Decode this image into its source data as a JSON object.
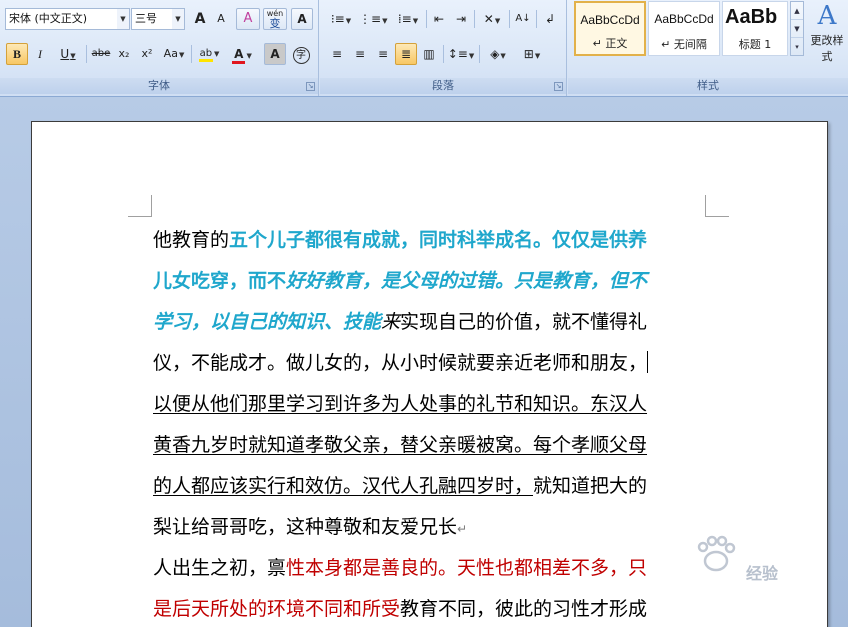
{
  "ribbon": {
    "font_group": {
      "label": "字体",
      "font_name": "宋体 (中文正文)",
      "font_size": "三号",
      "grow_font": "A",
      "shrink_font": "A",
      "clear_format": "A",
      "phonetic": "wén",
      "phonetic_char": "变",
      "char_border": "A",
      "bold": "B",
      "italic": "I",
      "underline": "U",
      "strikethrough": "abe",
      "subscript": "x₂",
      "superscript": "x²",
      "change_case": "Aa",
      "highlight": "ab",
      "font_color": "A",
      "char_shading": "A",
      "enclose": "字"
    },
    "paragraph_group": {
      "label": "段落"
    },
    "styles_group": {
      "label": "样式",
      "styles": [
        {
          "sample": "AaBbCcDd",
          "name": "↵ 正文"
        },
        {
          "sample": "AaBbCcDd",
          "name": "↵ 无间隔"
        },
        {
          "sample": "AaBb",
          "name": "标题 1"
        }
      ],
      "change_styles": "更改样式"
    }
  },
  "document": {
    "lines": [
      [
        {
          "t": "他教育的",
          "c": "plain"
        },
        {
          "t": "五个儿子都很有成就，同时科举成名。仅仅是供养",
          "c": "cyan"
        }
      ],
      [
        {
          "t": "儿女吃穿，而不",
          "c": "cyan"
        },
        {
          "t": "好好教育，是父母的过错。只是教育，但不",
          "c": "cyan-i"
        }
      ],
      [
        {
          "t": "学习，以自己的知识、技能",
          "c": "cyan-i"
        },
        {
          "t": "来",
          "c": "italic"
        },
        {
          "t": "实现自己的价值，就不懂得礼",
          "c": "plain"
        }
      ],
      [
        {
          "t": "仪，不能成才。做儿女的，从小时候就要亲近老师和朋友，",
          "c": "plain"
        }
      ],
      [
        {
          "t": "以便从他们那里学习到许多为人处事的礼节和知识。东汉人",
          "c": "ul"
        }
      ],
      [
        {
          "t": "黄香九岁时就知道孝敬父亲，替父亲暖被窝。每个孝顺父母",
          "c": "ul"
        }
      ],
      [
        {
          "t": "的人都应该实行和效仿。汉代人孔融四岁时，",
          "c": "ul"
        },
        {
          "t": "就知道把大的",
          "c": "plain"
        }
      ],
      [
        {
          "t": "梨让给哥哥吃，这种尊敬和友爱兄长",
          "c": "plain"
        }
      ],
      [
        {
          "t": "人出生之初，禀",
          "c": "plain"
        },
        {
          "t": "性本身都是善良的。天性也都相差不多，只",
          "c": "red"
        }
      ],
      [
        {
          "t": "是后天所处的环境不同和所受",
          "c": "red"
        },
        {
          "t": "教育不同，彼此的习性才形成",
          "c": "plain"
        }
      ]
    ],
    "paragraph_mark": "↵"
  },
  "watermark": {
    "text": "经验"
  },
  "colors": {
    "cyan": "#1fa7cc",
    "red": "#c00000",
    "ribbon_bg": "#dbe7f7",
    "doc_bg": "#a9c0e0"
  }
}
